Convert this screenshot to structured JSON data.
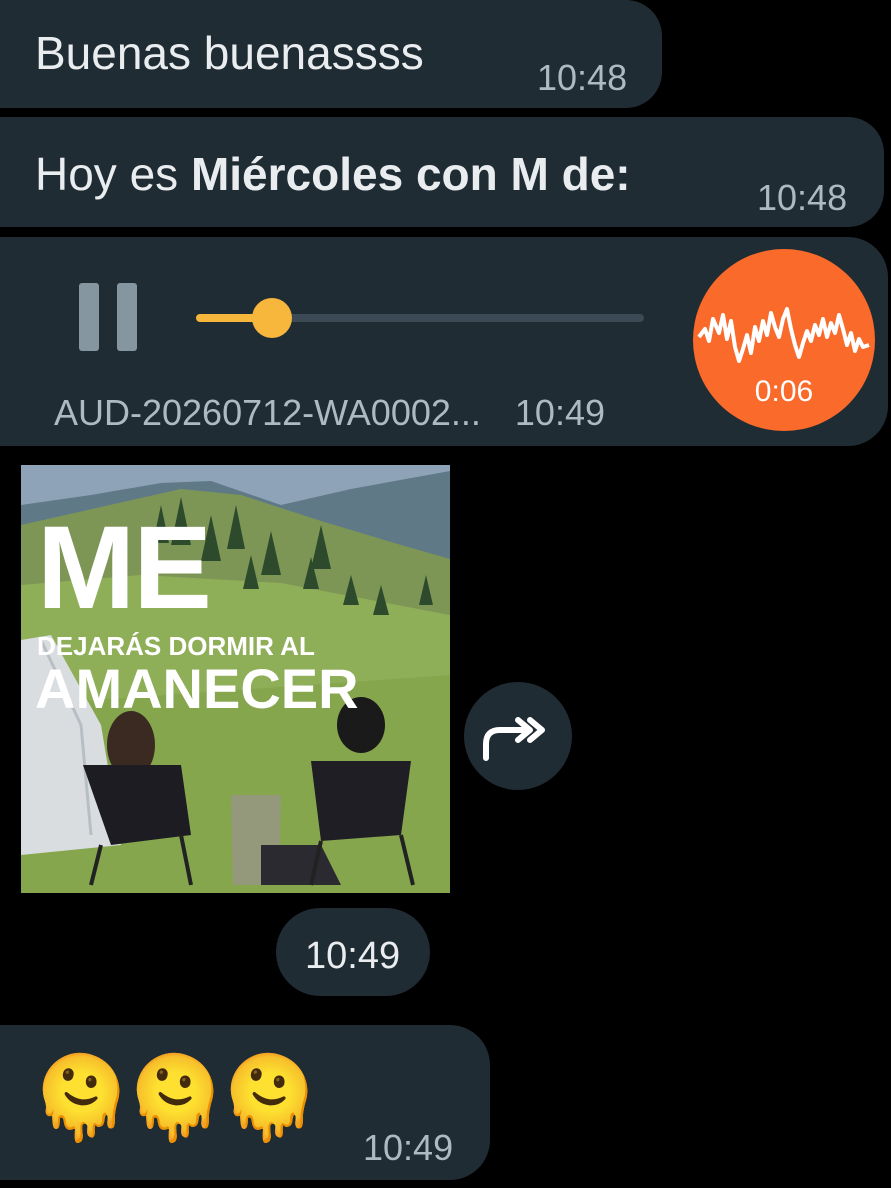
{
  "messages": [
    {
      "text": "Buenas buenassss",
      "time": "10:48"
    },
    {
      "text_plain": "Hoy es ",
      "text_bold": "Miércoles con M de:",
      "time": "10:48"
    }
  ],
  "audio": {
    "filename": "AUD-20260712-WA0002...",
    "time": "10:49",
    "duration": "0:06",
    "progress": 0.17,
    "state": "playing"
  },
  "media": {
    "overlay_line1": "ME",
    "overlay_line2": "DEJARÁS DORMIR AL",
    "overlay_line3": "AMANECER",
    "time": "10:49"
  },
  "emoji_message": {
    "emojis": [
      "🫠",
      "🫠",
      "🫠"
    ],
    "time": "10:49"
  },
  "icons": {
    "pause": "pause-icon",
    "forward": "forward-icon",
    "waveform": "waveform-icon"
  },
  "colors": {
    "bubble": "#202c33",
    "background": "#000000",
    "accent_orange": "#f96a2b",
    "progress_yellow": "#f6b73c",
    "meta_text": "#aebac1"
  }
}
